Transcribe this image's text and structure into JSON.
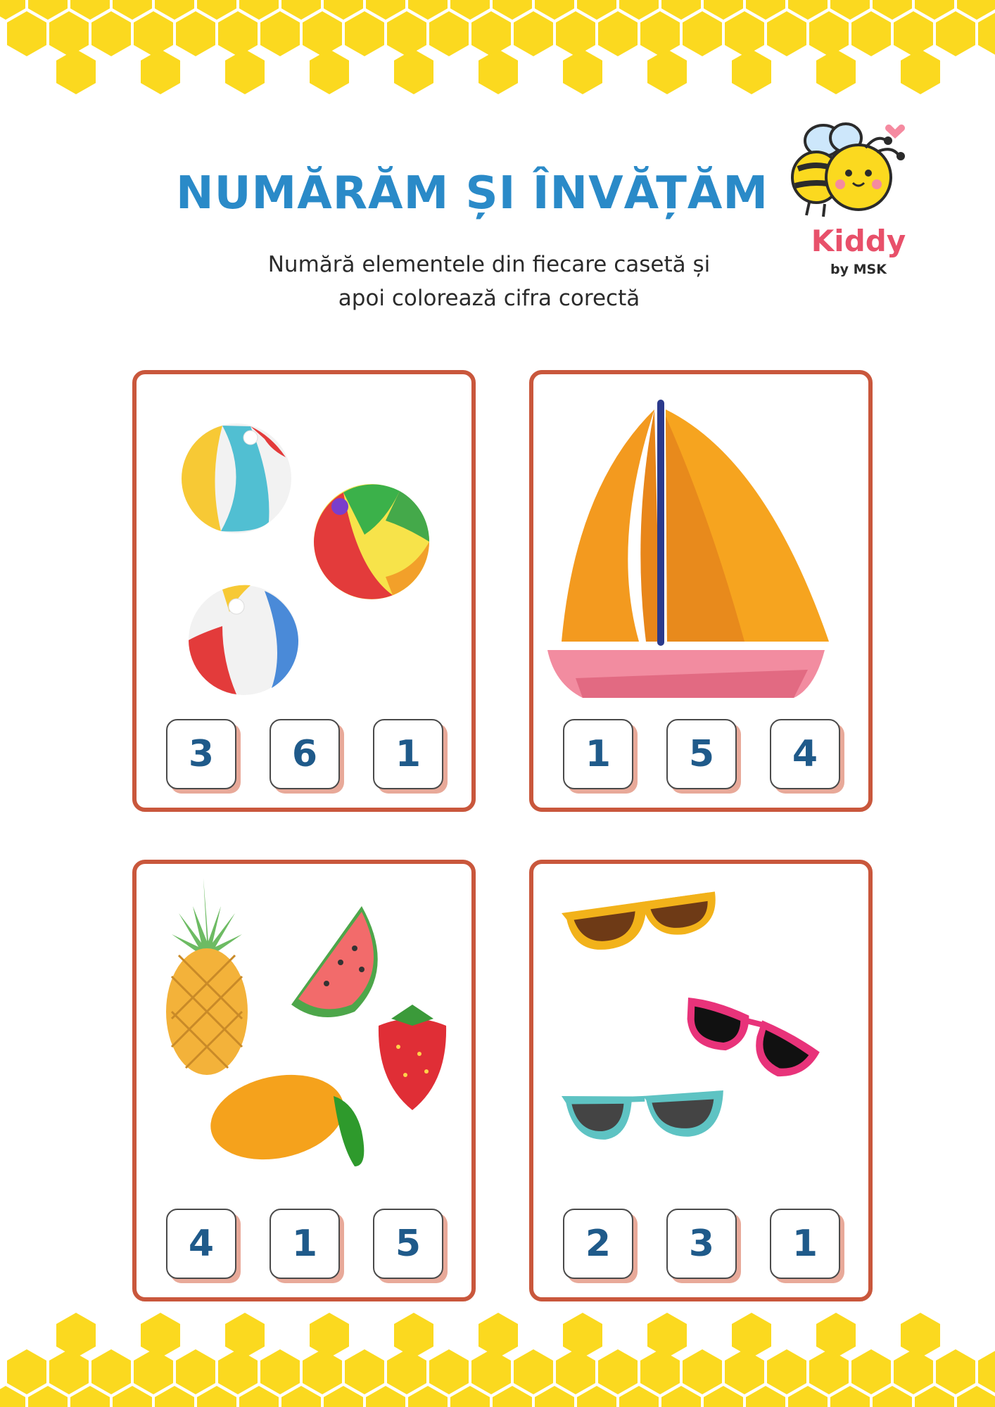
{
  "header": {
    "title": "NUMĂRĂM ȘI ÎNVĂȚĂM",
    "subtitle_line1": "Numără elementele din fiecare casetă și",
    "subtitle_line2": "apoi colorează cifra corectă"
  },
  "logo": {
    "brand": "Kiddy",
    "byline": "by MSK",
    "icon": "bee-icon"
  },
  "cards": [
    {
      "subject": "beach-balls",
      "options": [
        "3",
        "6",
        "1"
      ]
    },
    {
      "subject": "sailboat",
      "options": [
        "1",
        "5",
        "4"
      ]
    },
    {
      "subject": "fruits",
      "options": [
        "4",
        "1",
        "5"
      ]
    },
    {
      "subject": "sunglasses",
      "options": [
        "2",
        "3",
        "1"
      ]
    }
  ],
  "colors": {
    "title": "#2a8ac8",
    "card_border": "#c9573c",
    "number": "#1f5a8a",
    "honeycomb": "#fbd91f",
    "number_shadow": "#e8a999"
  }
}
